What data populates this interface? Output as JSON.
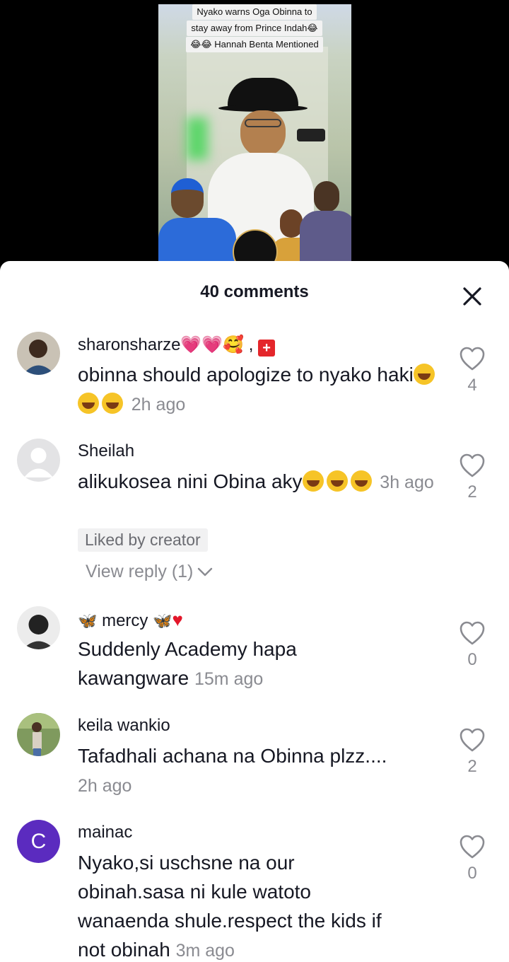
{
  "video": {
    "caption_line1": "Nyako warns Oga Obinna to",
    "caption_line2": "stay away from Prince Indah😂",
    "caption_line3": "😂😂 Hannah Benta Mentioned"
  },
  "sheet": {
    "title": "40 comments"
  },
  "comments": [
    {
      "author": "sharonsharze",
      "author_suffix": ",",
      "text": "obinna should apologize to nyako haki",
      "time": "2h ago",
      "likes": "4"
    },
    {
      "author": "Sheilah",
      "text": "alikukosea nini Obina aky",
      "time": "3h ago",
      "likes": "2",
      "badge": "Liked by creator",
      "view_reply": "View reply (1)"
    },
    {
      "author": "mercy",
      "text_line1": "Suddenly Academy hapa",
      "text_line2": "kawangware",
      "time": "15m ago",
      "likes": "0"
    },
    {
      "author": "keila wankio",
      "text": "Tafadhali achana na Obinna plzz....",
      "time": "2h ago",
      "likes": "2"
    },
    {
      "author": "mainac",
      "avatar_letter": "C",
      "avatar_color": "#5b2bbf",
      "text_line1": "Nyako,si uschsne na our",
      "text_line2": "obinah.sasa ni kule watoto",
      "text_line3": "wanaenda shule.respect the kids if",
      "text_line4": "not obinah",
      "time": "3m ago",
      "likes": "0"
    }
  ]
}
